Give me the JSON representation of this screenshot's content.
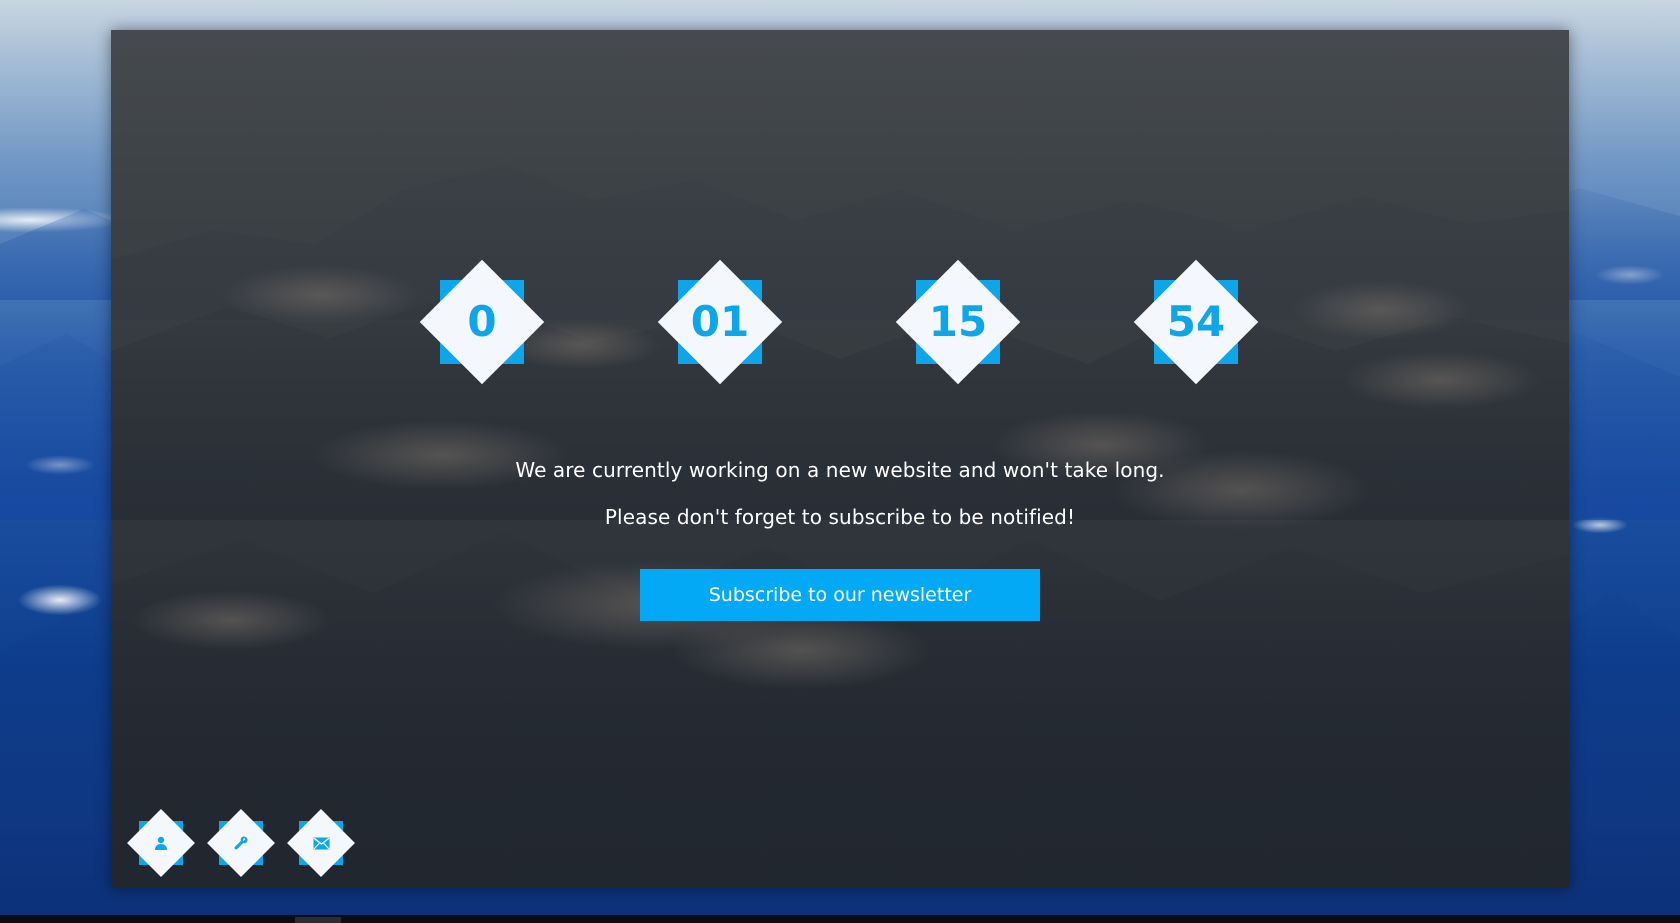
{
  "countdown": {
    "units": [
      {
        "value": "0"
      },
      {
        "value": "01"
      },
      {
        "value": "15"
      },
      {
        "value": "54"
      }
    ]
  },
  "message": {
    "line1": "We are currently working on a new website and won't take long.",
    "line2": "Please don't forget to subscribe to be notified!"
  },
  "subscribe": {
    "label": "Subscribe to our newsletter"
  },
  "social": {
    "icons": [
      "user-icon",
      "wrench-icon",
      "mail-icon"
    ]
  },
  "colors": {
    "accent": "#03a9f4",
    "diamond": "#f4f8fc",
    "panel": "#3a3f45",
    "text": "#ffffff"
  }
}
